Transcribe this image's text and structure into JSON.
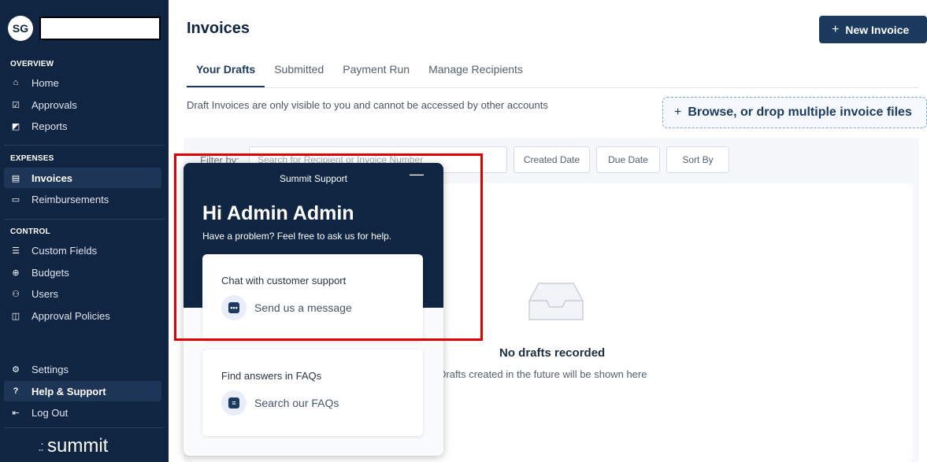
{
  "sidebar": {
    "avatar_initials": "SG",
    "sections": {
      "overview": "OVERVIEW",
      "expenses": "EXPENSES",
      "control": "CONTROL"
    },
    "items": {
      "home": "Home",
      "approvals": "Approvals",
      "reports": "Reports",
      "invoices": "Invoices",
      "reimbursements": "Reimbursements",
      "custom_fields": "Custom Fields",
      "budgets": "Budgets",
      "users": "Users",
      "approval_policies": "Approval Policies",
      "settings": "Settings",
      "help_support": "Help & Support",
      "log_out": "Log Out"
    },
    "logo_text": "summit"
  },
  "header": {
    "title": "Invoices",
    "new_invoice_label": "New Invoice"
  },
  "tabs": [
    "Your Drafts",
    "Submitted",
    "Payment Run",
    "Manage Recipients"
  ],
  "notice": "Draft Invoices are only visible to you and cannot be accessed by other accounts",
  "browse_label": "Browse, or drop multiple invoice files",
  "filter": {
    "label": "Filter by:",
    "search_placeholder": "Search for Recipient or Invoice Number",
    "buttons": [
      "Created Date",
      "Due Date",
      "Sort By"
    ]
  },
  "empty_state": {
    "title": "No drafts recorded",
    "subtitle": "Drafts created in the future will be shown here"
  },
  "support": {
    "title": "Summit Support",
    "greeting": "Hi Admin Admin",
    "description": "Have a problem? Feel free to ask us for help.",
    "chat_card": {
      "title": "Chat with customer support",
      "action": "Send us a message"
    },
    "faq_card": {
      "title": "Find answers in FAQs",
      "action": "Search our FAQs"
    }
  },
  "colors": {
    "sidebar_bg": "#102542",
    "accent": "#1c3a5e",
    "highlight": "#e00000"
  }
}
